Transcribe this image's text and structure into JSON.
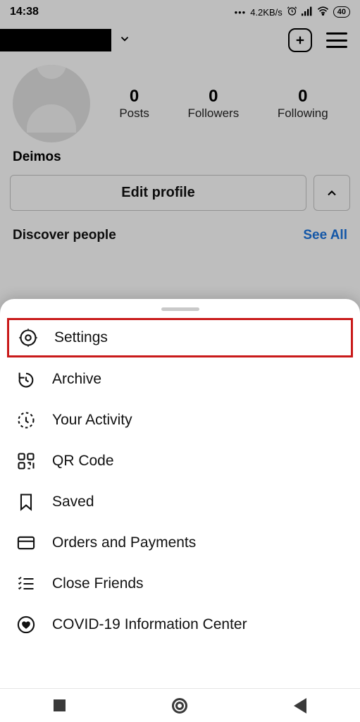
{
  "status": {
    "time": "14:38",
    "net_speed": "4.2KB/s",
    "battery": "40"
  },
  "profile": {
    "display_name": "Deimos",
    "stats": {
      "posts": {
        "value": "0",
        "label": "Posts"
      },
      "followers": {
        "value": "0",
        "label": "Followers"
      },
      "following": {
        "value": "0",
        "label": "Following"
      }
    },
    "edit_label": "Edit profile",
    "discover_label": "Discover people",
    "see_all_label": "See All"
  },
  "menu": {
    "items": [
      {
        "label": "Settings"
      },
      {
        "label": "Archive"
      },
      {
        "label": "Your Activity"
      },
      {
        "label": "QR Code"
      },
      {
        "label": "Saved"
      },
      {
        "label": "Orders and Payments"
      },
      {
        "label": "Close Friends"
      },
      {
        "label": "COVID-19 Information Center"
      }
    ]
  }
}
